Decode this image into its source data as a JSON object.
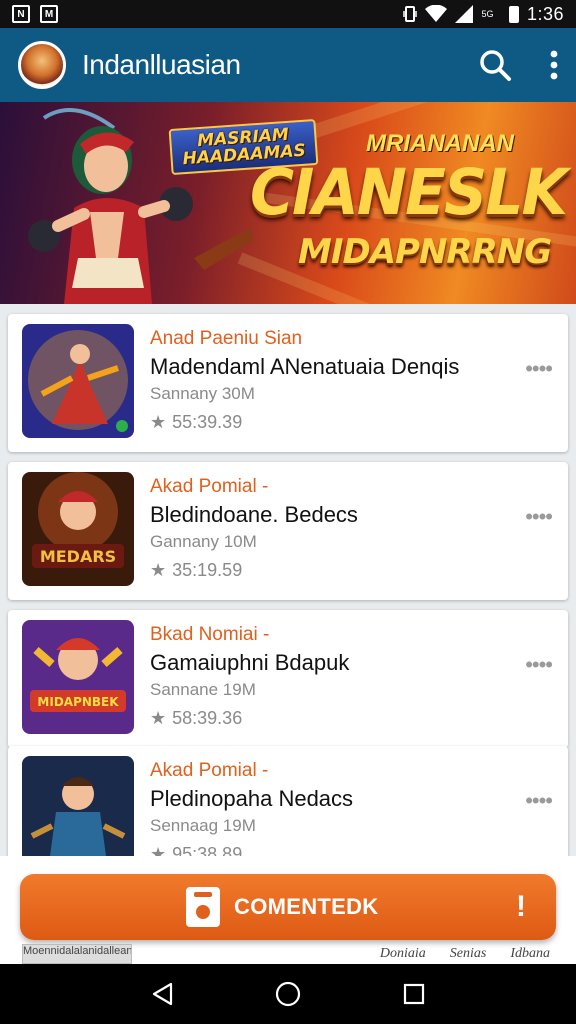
{
  "status_bar": {
    "time": "1:36",
    "network": "5G   ",
    "app_icon_1": "N",
    "app_icon_2": "M"
  },
  "app_bar": {
    "title": "Indanlluasian",
    "icons": [
      "search-icon",
      "overflow-menu-icon"
    ]
  },
  "banner": {
    "badge": "MASRIAM\nHAADAAMAS",
    "tagline": "MRIANANAN",
    "title": "CIANESLK",
    "subtitle": "MIDAPNRRNG"
  },
  "list": {
    "items": [
      {
        "kicker": "Anad Paeniu Sian",
        "title": "Madendaml ANenatuaia Denqis",
        "meta": "Sannany 30M",
        "rating": "55:39.39",
        "thumb_palette": [
          "#2a2a8a",
          "#c8342a",
          "#f4a21a"
        ]
      },
      {
        "kicker": "Akad Pomial -",
        "title": "Bledindoane. Bedecs",
        "meta": "Gannany 10M",
        "rating": "35:19.59",
        "thumb_palette": [
          "#3a1a0a",
          "#a8481c",
          "#f2c040"
        ],
        "thumb_text": "MEDARS"
      },
      {
        "kicker": "Bkad Nomiai -",
        "title": "Gamaiuphni Bdapuk",
        "meta": "Sannane 19M",
        "rating": "58:39.36",
        "thumb_palette": [
          "#5a2a8a",
          "#d33a2a",
          "#f2b832"
        ],
        "thumb_text": "MIDAPNBEK"
      },
      {
        "kicker": "Akad Pomial -",
        "title": "Pledinopaha Nedacs",
        "meta": "Sennaag 19M",
        "rating": "95:38.89",
        "thumb_palette": [
          "#1a2a4a",
          "#2a6a9a",
          "#c6903a"
        ]
      }
    ]
  },
  "cta": {
    "label": "COMENTEDK",
    "alert": "!"
  },
  "footer": {
    "logo_text": "Moennidalalanidalleann",
    "links": [
      "Doniaia",
      "Senias",
      "Idbana"
    ]
  },
  "colors": {
    "app_bar": "#0e5a85",
    "accent": "#e0601e",
    "cta": "#e86a20"
  }
}
